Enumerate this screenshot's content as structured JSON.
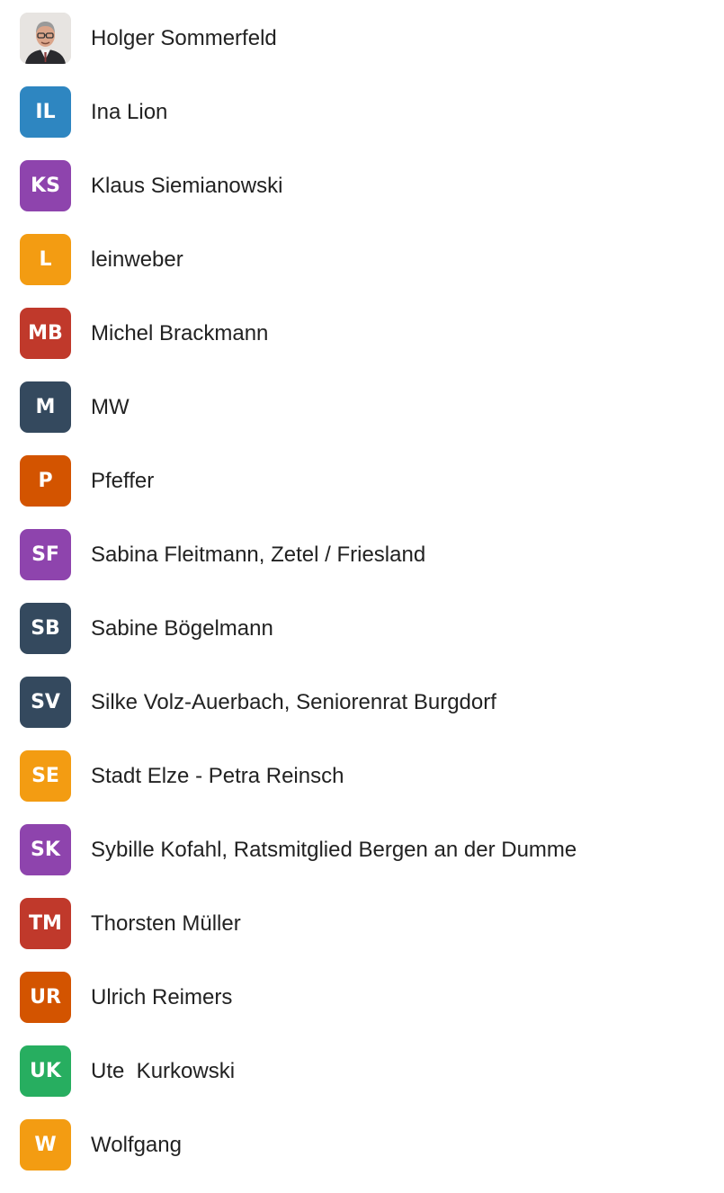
{
  "members": [
    {
      "name": "Holger Sommerfeld",
      "initials": "",
      "avatar_type": "photo",
      "color": "#e7e4e1"
    },
    {
      "name": "Ina Lion",
      "initials": "IL",
      "avatar_type": "initials",
      "color": "#2e86c1"
    },
    {
      "name": "Klaus Siemianowski",
      "initials": "KS",
      "avatar_type": "initials",
      "color": "#8e44ad"
    },
    {
      "name": "leinweber",
      "initials": "L",
      "avatar_type": "initials",
      "color": "#f39c12"
    },
    {
      "name": "Michel Brackmann",
      "initials": "MB",
      "avatar_type": "initials",
      "color": "#c0392b"
    },
    {
      "name": "MW",
      "initials": "M",
      "avatar_type": "initials",
      "color": "#34495e"
    },
    {
      "name": "Pfeffer",
      "initials": "P",
      "avatar_type": "initials",
      "color": "#d35400"
    },
    {
      "name": "Sabina Fleitmann, Zetel / Friesland",
      "initials": "SF",
      "avatar_type": "initials",
      "color": "#8e44ad"
    },
    {
      "name": "Sabine Bögelmann",
      "initials": "SB",
      "avatar_type": "initials",
      "color": "#34495e"
    },
    {
      "name": "Silke Volz-Auerbach, Seniorenrat Burgdorf",
      "initials": "SV",
      "avatar_type": "initials",
      "color": "#34495e"
    },
    {
      "name": "Stadt Elze - Petra Reinsch",
      "initials": "SE",
      "avatar_type": "initials",
      "color": "#f39c12"
    },
    {
      "name": "Sybille Kofahl, Ratsmitglied Bergen an der Dumme",
      "initials": "SK",
      "avatar_type": "initials",
      "color": "#8e44ad"
    },
    {
      "name": "Thorsten Müller",
      "initials": "TM",
      "avatar_type": "initials",
      "color": "#c0392b"
    },
    {
      "name": "Ulrich Reimers",
      "initials": "UR",
      "avatar_type": "initials",
      "color": "#d35400"
    },
    {
      "name": "Ute  Kurkowski",
      "initials": "UK",
      "avatar_type": "initials",
      "color": "#27ae60"
    },
    {
      "name": "Wolfgang",
      "initials": "W",
      "avatar_type": "initials",
      "color": "#f39c12"
    }
  ]
}
